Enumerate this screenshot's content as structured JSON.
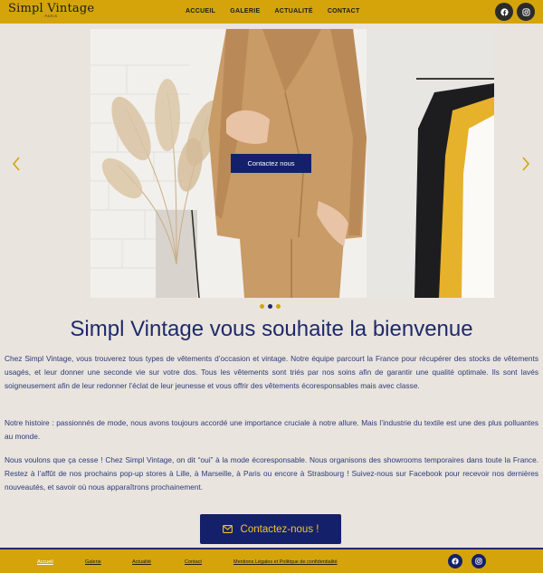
{
  "header": {
    "logo_main": "Simpl Vintage",
    "logo_sub": "PARIS",
    "nav": [
      "ACCUEIL",
      "GALERIE",
      "ACTUALITÉ",
      "CONTACT"
    ],
    "social": [
      "facebook-icon",
      "instagram-icon"
    ]
  },
  "hero": {
    "button_label": "Contactez nous",
    "slide_count": 3,
    "active_slide": 2
  },
  "main": {
    "title": "Simpl Vintage vous souhaite la bienvenue",
    "paragraphs": [
      "Chez Simpl Vintage, vous trouverez tous types de vêtements d’occasion et vintage. Notre équipe parcourt la France pour récupérer des stocks de vêtements usagés, et leur donner une seconde vie sur votre dos. Tous les vêtements sont triés par nos soins afin de garantir une qualité optimale. Ils sont lavés soigneusement afin de leur redonner l’éclat de leur jeunesse et vous offrir des vêtements écoresponsables mais avec classe.",
      "Notre histoire : passionnés de mode, nous avons toujours accordé une importance cruciale à notre allure. Mais l’industrie du textile est une des plus polluantes au monde.",
      "Nous voulons que ça cesse ! Chez Simpl Vintage, on dit “oui” à la mode écoresponsable. Nous organisons des showrooms temporaires dans toute la France. Restez à l’affût de nos prochains pop-up stores à Lille, à Marseille, à Paris ou encore à Strasbourg ! Suivez-nous sur Facebook pour recevoir nos dernières nouveautés, et savoir où nous apparaîtrons prochainement."
    ],
    "cta_label": "Contactez-nous !"
  },
  "footer": {
    "links": [
      "Accueil",
      "Galerie",
      "Actualité",
      "Contact",
      "Mentions Légales et Politique de confidentialité"
    ]
  },
  "colors": {
    "gold": "#d4a40a",
    "navy": "#1f2a6b",
    "background": "#e9e4de"
  }
}
